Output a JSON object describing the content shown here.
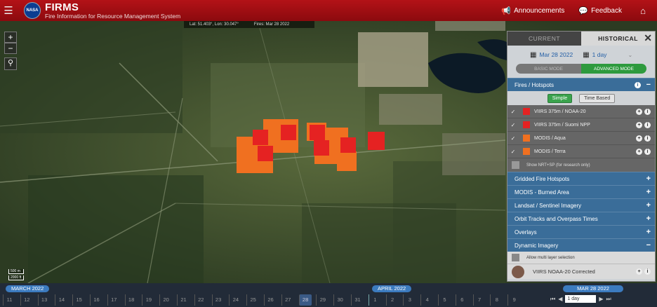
{
  "header": {
    "title": "FIRMS",
    "subtitle": "Fire Information for Resource Management System",
    "logo_text": "NASA",
    "announcements_label": "Announcements",
    "feedback_label": "Feedback"
  },
  "info_strip": {
    "coords": "Lat: 51.403°, Lon: 30.047°",
    "fires_date": "Fires: Mar 28 2022"
  },
  "map_controls": {
    "zoom_in": "+",
    "zoom_out": "−"
  },
  "scale": {
    "metric": "500 m",
    "imperial": "2000 ft"
  },
  "panel": {
    "tabs": {
      "current": "CURRENT",
      "historical": "HISTORICAL"
    },
    "date": "Mar 28 2022",
    "duration": "1 day",
    "modes": {
      "basic": "BASIC MODE",
      "advanced": "ADVANCED MODE"
    },
    "fires_section": {
      "title": "Fires / Hotspots",
      "sub_tabs": {
        "simple": "Simple",
        "time_based": "Time Based"
      },
      "layers": [
        {
          "label": "VIIRS 375m / NOAA-20",
          "color": "#e52222"
        },
        {
          "label": "VIIRS 375m / Suomi NPP",
          "color": "#e52222"
        },
        {
          "label": "MODIS / Aqua",
          "color": "#f07020"
        },
        {
          "label": "MODIS / Terra",
          "color": "#f07020"
        }
      ],
      "nrt_label": "Show NRT+SP (for research only)"
    },
    "sections": [
      "Gridded Fire Hotspots",
      "MODIS - Burned Area",
      "Landsat / Sentinel Imagery",
      "Orbit Tracks and Overpass Times",
      "Overlays"
    ],
    "dynamic_imagery": {
      "title": "Dynamic Imagery",
      "multi_label": "Allow multi layer selection",
      "first_layer": "VIIRS NOAA-20 Corrected"
    }
  },
  "timeline": {
    "months": {
      "march": "MARCH 2022",
      "april": "APRIL 2022"
    },
    "march_days": [
      "11",
      "12",
      "13",
      "14",
      "15",
      "16",
      "17",
      "18",
      "19",
      "20",
      "21",
      "22",
      "23",
      "24",
      "25",
      "26",
      "27",
      "28",
      "29",
      "30",
      "31"
    ],
    "april_days": [
      "1",
      "2",
      "3",
      "4",
      "5",
      "6",
      "7",
      "8",
      "9"
    ],
    "selected_day": "28",
    "current_date": "MAR 28 2022",
    "duration": "1 day"
  },
  "colors": {
    "header_red": "#a3161b",
    "panel_blue": "#3a6d99",
    "green_active": "#2e9a3e",
    "viirs_red": "#e52222",
    "modis_orange": "#f07020"
  },
  "icons": [
    "hamburger-icon",
    "megaphone-icon",
    "comment-icon",
    "home-icon",
    "location-icon",
    "calendar-icon",
    "close-icon",
    "info-icon",
    "check-icon"
  ]
}
